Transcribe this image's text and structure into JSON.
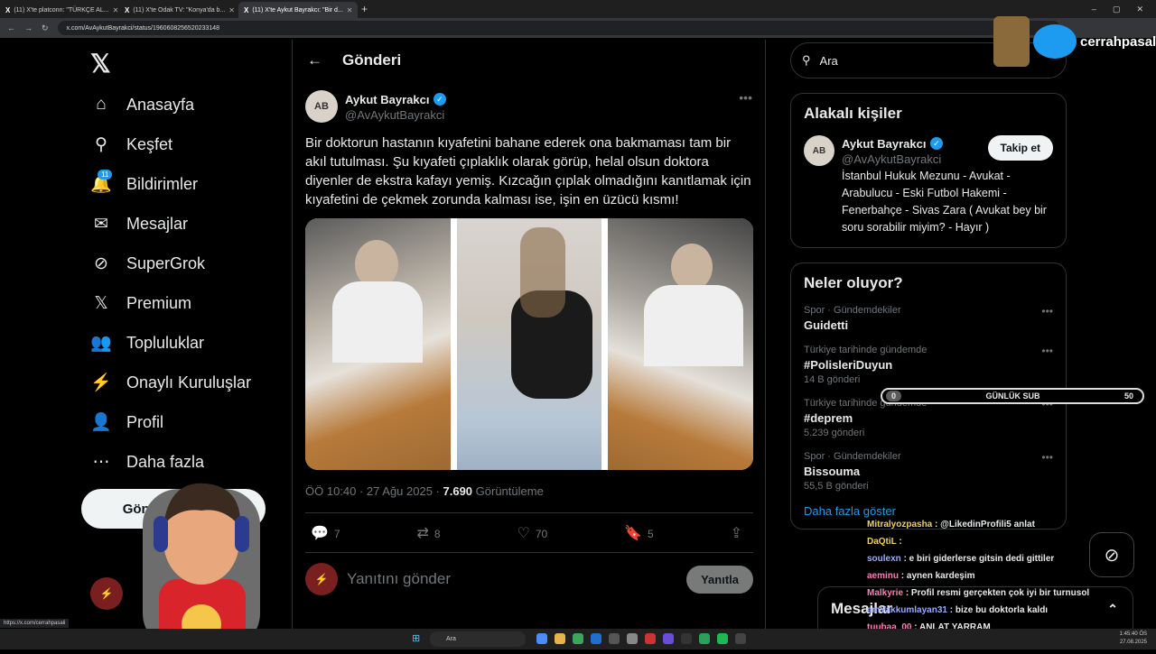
{
  "browser": {
    "tabs": [
      {
        "label": "(11) X'te platconn: \"TÜRKÇE AL...",
        "active": false
      },
      {
        "label": "(11) X'te Odak TV: \"Konya'da b...",
        "active": false
      },
      {
        "label": "(11) X'te Aykut Bayrakcı: \"Bir d...",
        "active": true
      }
    ],
    "url": "x.com/AvAykutBayrakci/status/1960608256520233148",
    "new_tab": "+",
    "status_url": "https://x.com/cerrahpasali"
  },
  "leftnav": {
    "items": [
      {
        "label": "Anasayfa",
        "icon": "home-icon",
        "glyph": "⌂"
      },
      {
        "label": "Keşfet",
        "icon": "search-icon",
        "glyph": "⚲"
      },
      {
        "label": "Bildirimler",
        "icon": "bell-icon",
        "glyph": "🔔",
        "badge": "11"
      },
      {
        "label": "Mesajlar",
        "icon": "mail-icon",
        "glyph": "✉"
      },
      {
        "label": "SuperGrok",
        "icon": "grok-icon",
        "glyph": "⊘"
      },
      {
        "label": "Premium",
        "icon": "x-icon",
        "glyph": "𝕏"
      },
      {
        "label": "Topluluklar",
        "icon": "people-icon",
        "glyph": "👥"
      },
      {
        "label": "Onaylı Kuruluşlar",
        "icon": "lightning-icon",
        "glyph": "⚡"
      },
      {
        "label": "Profil",
        "icon": "person-icon",
        "glyph": "👤"
      },
      {
        "label": "Daha fazla",
        "icon": "more-circle-icon",
        "glyph": "⋯"
      }
    ],
    "post_button": "Gönderi yayınla",
    "logo": "𝕏"
  },
  "main": {
    "header": "Gönderi",
    "author": {
      "name": "Aykut Bayrakcı",
      "handle": "@AvAykutBayrakci"
    },
    "text": "Bir doktorun hastanın kıyafetini bahane ederek ona bakmaması tam bir akıl tutulması. Şu kıyafeti çıplaklık olarak görüp, helal olsun doktora diyenler de ekstra kafayı yemiş. Kızcağın çıplak olmadığını kanıtlamak için kıyafetini de çekmek zorunda kalması ise, işin en üzücü kısmı!",
    "time": "ÖÖ 10:40 · 27 Ağu 2025 · ",
    "views": "7.690",
    "views_label": " Görüntüleme",
    "actions": {
      "replies": "7",
      "reposts": "8",
      "likes": "70",
      "bookmarks": "5"
    },
    "reply_placeholder": "Yanıtını gönder",
    "reply_button": "Yanıtla"
  },
  "right": {
    "search_placeholder": "Ara",
    "related": {
      "title": "Alakalı kişiler",
      "name": "Aykut Bayrakcı",
      "handle": "@AvAykutBayrakci",
      "follow": "Takip et",
      "bio": "İstanbul Hukuk Mezunu - Avukat - Arabulucu - Eski Futbol Hakemi - Fenerbahçe - Sivas Zara ( Avukat bey bir soru sorabilir miyim? - Hayır )"
    },
    "trends": {
      "title": "Neler oluyor?",
      "items": [
        {
          "context": "Spor · Gündemdekiler",
          "topic": "Guidetti",
          "count": ""
        },
        {
          "context": "Türkiye tarihinde gündemde",
          "topic": "#PolisleriDuyun",
          "count": "14 B gönderi"
        },
        {
          "context": "Türkiye tarihinde gündemde",
          "topic": "#deprem",
          "count": "5.239 gönderi"
        },
        {
          "context": "Spor · Gündemdekiler",
          "topic": "Bissouma",
          "count": "55,5 B gönderi"
        }
      ],
      "show_more": "Daha fazla göster"
    }
  },
  "overlay": {
    "brand": "cerrahpasali",
    "sub_bar": {
      "start": "0",
      "label": "GÜNLÜK SUB",
      "goal": "50"
    },
    "chat": [
      {
        "user": "Mitralyozpasha",
        "msg": ": @LikedinProfili5 anlat"
      },
      {
        "user": "DaQtiL",
        "msg": ":"
      },
      {
        "user": "soulexn",
        "msg": ": e biri giderlerse gitsin dedi gittiler"
      },
      {
        "user": "aeminu",
        "msg": ": aynen kardeşim"
      },
      {
        "user": "Malkyrie",
        "msg": ": Profil resmi gerçekten çok iyi bir turnusol"
      },
      {
        "user": "amVakkumlayan31",
        "msg": ": bize bu doktorla kaldı"
      },
      {
        "user": "tuubaa_00",
        "msg": ": ANLAT YARRAM"
      }
    ],
    "dock_label": "Mesajlar"
  },
  "taskbar": {
    "search": "Ara",
    "time": "1:45:40 ÖS",
    "date": "27.08.2025"
  },
  "colors": {
    "accent": "#1d9bf0",
    "bg": "#000000",
    "border": "#2f3336"
  }
}
